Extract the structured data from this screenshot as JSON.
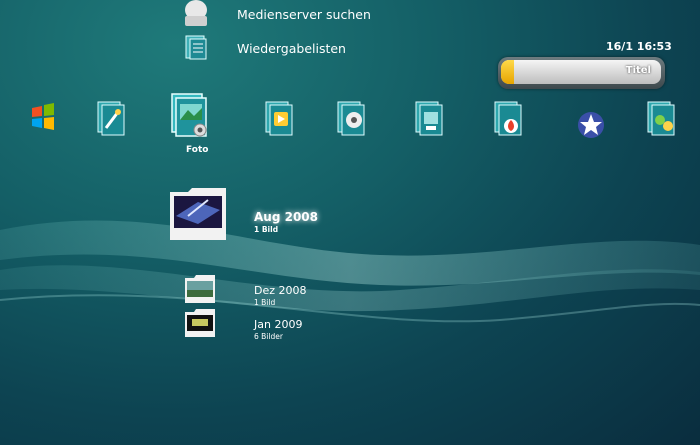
{
  "menu": {
    "items": [
      {
        "label": "Medienserver suchen",
        "icon": "media-server-icon"
      },
      {
        "label": "Wiedergabelisten",
        "icon": "playlist-icon"
      }
    ]
  },
  "status": {
    "clock": "16/1 16:53",
    "progress_fraction": 0.08,
    "progress_label": "Titel"
  },
  "categories": {
    "selected_label": "Foto",
    "icons": [
      "windows-logo-icon",
      "tools-folder-icon",
      "photo-folder-icon",
      "video-folder-icon",
      "film-folder-icon",
      "media-folder-icon",
      "flame-folder-icon",
      "star-network-icon",
      "friends-folder-icon"
    ]
  },
  "content": {
    "folders": [
      {
        "title": "Aug 2008",
        "subtitle": "1 Bild"
      },
      {
        "title": "Dez 2008",
        "subtitle": "1 Bild"
      },
      {
        "title": "Jan 2009",
        "subtitle": "6 Bilder"
      }
    ]
  },
  "colors": {
    "accent": "#ffc400",
    "background": "#145f66"
  }
}
